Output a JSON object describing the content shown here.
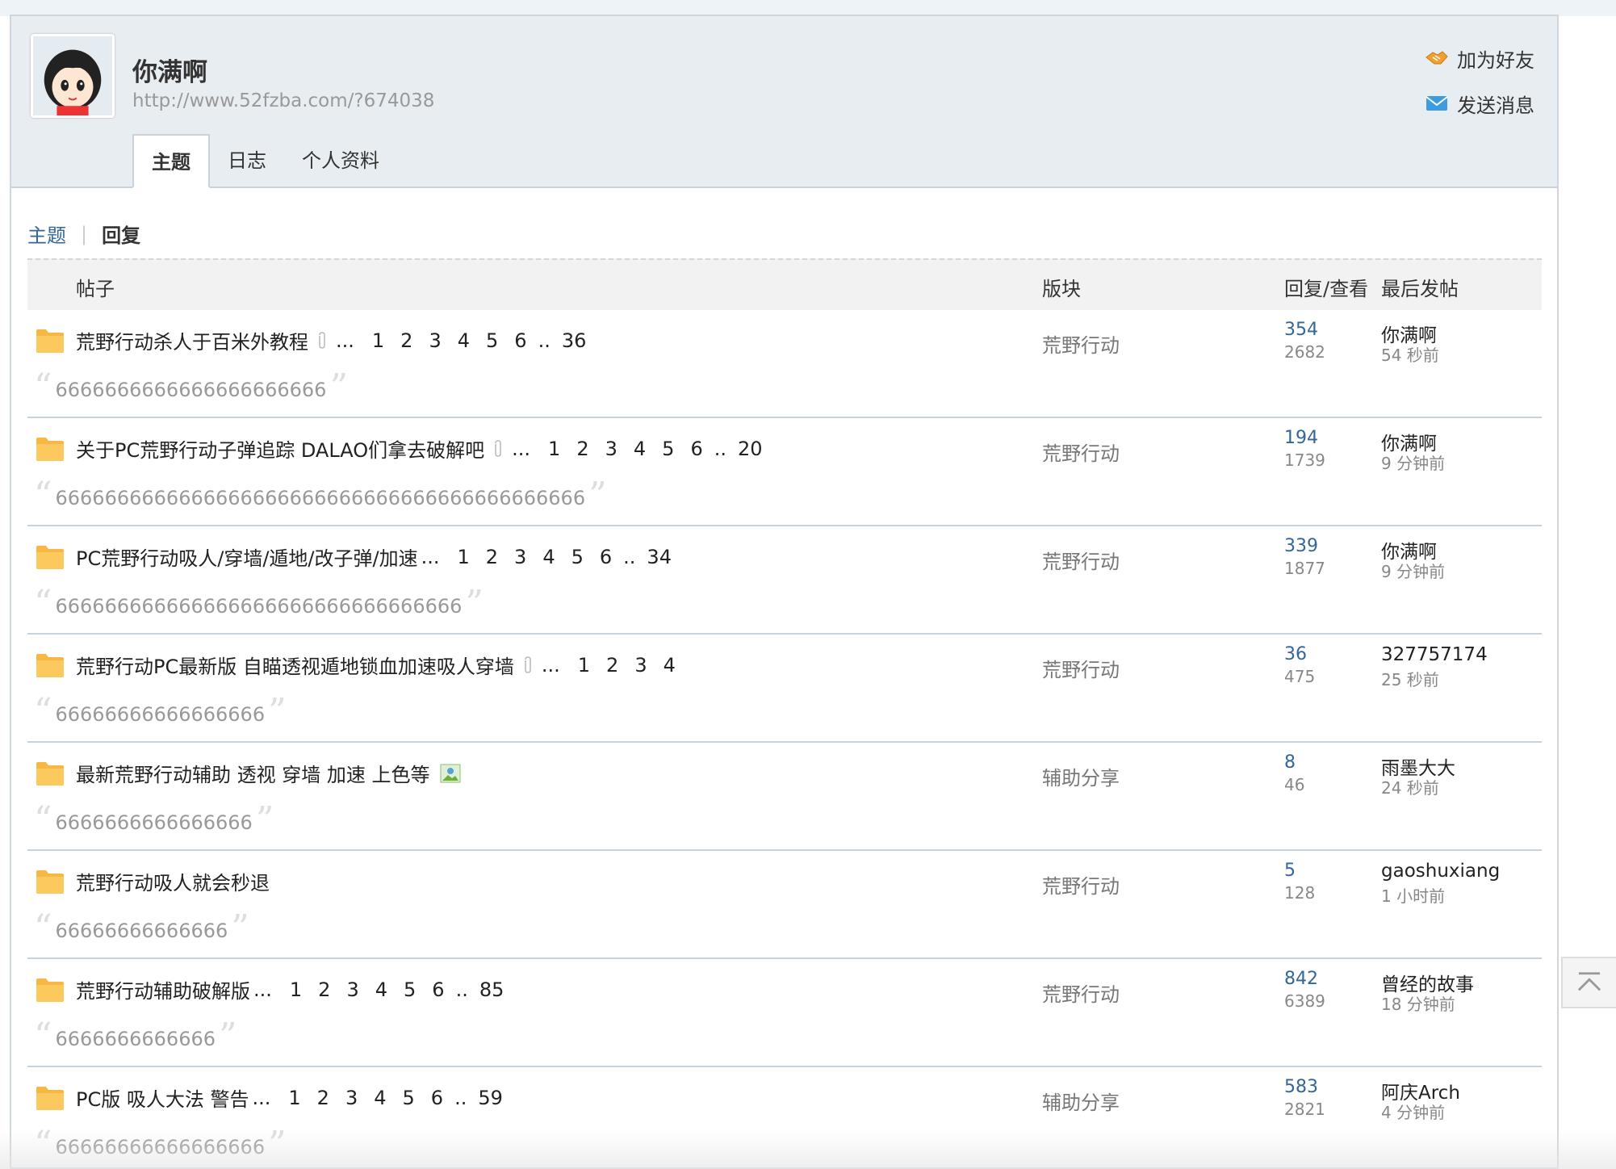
{
  "profile": {
    "name": "你满啊",
    "url": "http://www.52fzba.com/?674038",
    "actions": {
      "add_friend": "加为好友",
      "send_message": "发送消息"
    }
  },
  "tabs": [
    {
      "label": "主题",
      "active": true
    },
    {
      "label": "日志",
      "active": false
    },
    {
      "label": "个人资料",
      "active": false
    }
  ],
  "subtabs": {
    "topics": "主题",
    "replies": "回复"
  },
  "table": {
    "headers": {
      "post": "帖子",
      "forum": "版块",
      "reply_view": "回复/查看",
      "last_post": "最后发帖"
    },
    "rows": [
      {
        "title": "荒野行动杀人于百米外教程",
        "attach": true,
        "image": false,
        "pages": [
          "1",
          "2",
          "3",
          "4",
          "5",
          "6"
        ],
        "last_page": "36",
        "forum": "荒野行动",
        "replies": "354",
        "views": "2682",
        "last_user": "你满啊",
        "last_time": "54 秒前",
        "quote": "6666666666666666666666"
      },
      {
        "title": "关于PC荒野行动子弹追踪 DALAO们拿去破解吧",
        "attach": true,
        "image": false,
        "pages": [
          "1",
          "2",
          "3",
          "4",
          "5",
          "6"
        ],
        "last_page": "20",
        "forum": "荒野行动",
        "replies": "194",
        "views": "1739",
        "last_user": "你满啊",
        "last_time": "9 分钟前",
        "quote": "6666666666666666666666666666666666666666666"
      },
      {
        "title": "PC荒野行动吸人/穿墙/遁地/改子弹/加速",
        "attach": false,
        "image": false,
        "pages": [
          "1",
          "2",
          "3",
          "4",
          "5",
          "6"
        ],
        "last_page": "34",
        "forum": "荒野行动",
        "replies": "339",
        "views": "1877",
        "last_user": "你满啊",
        "last_time": "9 分钟前",
        "quote": "666666666666666666666666666666666"
      },
      {
        "title": "荒野行动PC最新版 自瞄透视遁地锁血加速吸人穿墙",
        "attach": true,
        "image": false,
        "pages": [
          "1",
          "2",
          "3",
          "4"
        ],
        "last_page": "",
        "forum": "荒野行动",
        "replies": "36",
        "views": "475",
        "last_user": "327757174",
        "last_time": "25 秒前",
        "quote": "66666666666666666"
      },
      {
        "title": "最新荒野行动辅助 透视 穿墙 加速 上色等",
        "attach": false,
        "image": true,
        "pages": [],
        "last_page": "",
        "forum": "辅助分享",
        "replies": "8",
        "views": "46",
        "last_user": "雨墨大大",
        "last_time": "24 秒前",
        "quote": "6666666666666666"
      },
      {
        "title": "荒野行动吸人就会秒退",
        "attach": false,
        "image": false,
        "pages": [],
        "last_page": "",
        "forum": "荒野行动",
        "replies": "5",
        "views": "128",
        "last_user": "gaoshuxiang",
        "last_time": "1 小时前",
        "quote": "66666666666666"
      },
      {
        "title": "荒野行动辅助破解版",
        "attach": false,
        "image": false,
        "pages": [
          "1",
          "2",
          "3",
          "4",
          "5",
          "6"
        ],
        "last_page": "85",
        "forum": "荒野行动",
        "replies": "842",
        "views": "6389",
        "last_user": "曾经的故事",
        "last_time": "18 分钟前",
        "quote": "6666666666666"
      },
      {
        "title": "PC版 吸人大法 警告",
        "attach": false,
        "image": false,
        "pages": [
          "1",
          "2",
          "3",
          "4",
          "5",
          "6"
        ],
        "last_page": "59",
        "forum": "辅助分享",
        "replies": "583",
        "views": "2821",
        "last_user": "阿庆Arch",
        "last_time": "4 分钟前",
        "quote": "66666666666666666"
      }
    ]
  },
  "icons": {
    "folder": "folder-icon",
    "attachment": "paperclip-icon",
    "image": "image-icon",
    "add_friend": "handshake-icon",
    "message": "envelope-icon",
    "back_to_top": "arrow-up-icon"
  },
  "colors": {
    "link": "#336699",
    "folder": "#f7b843",
    "header_bg": "#e8edf2"
  }
}
